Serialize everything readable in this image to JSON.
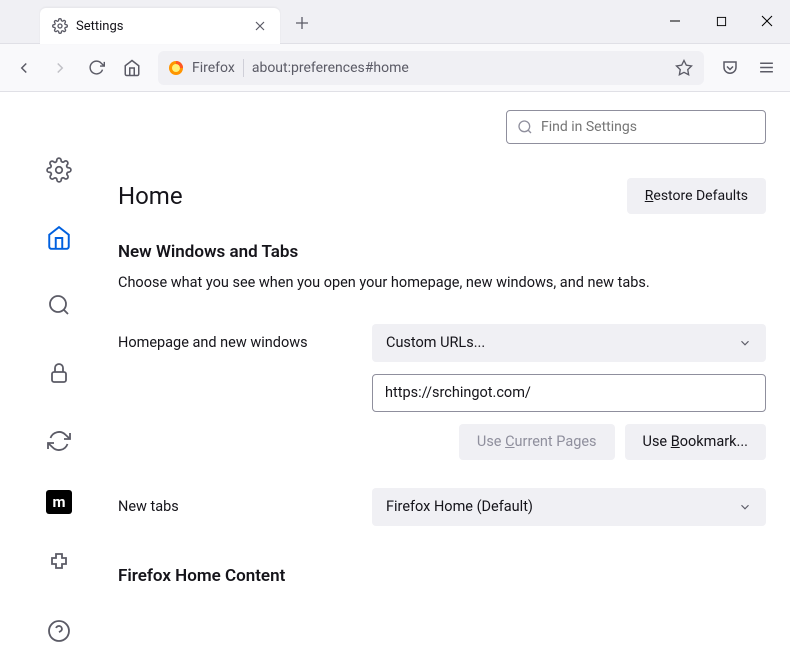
{
  "tab": {
    "title": "Settings"
  },
  "urlbar": {
    "context": "Firefox",
    "url": "about:preferences#home"
  },
  "search": {
    "placeholder": "Find in Settings"
  },
  "page": {
    "title": "Home",
    "restore": "estore Defaults",
    "restore_prefix": "R",
    "section1_title": "New Windows and Tabs",
    "section1_desc": "Choose what you see when you open your homepage, new windows, and new tabs.",
    "homepage_label": "Homepage and new windows",
    "homepage_select": "Custom URLs...",
    "homepage_value": "https://srchingot.com/",
    "use_current_prefix": "Use ",
    "use_current_ul": "C",
    "use_current_suffix": "urrent Pages",
    "use_bookmark_prefix": "Use ",
    "use_bookmark_ul": "B",
    "use_bookmark_suffix": "ookmark...",
    "newtabs_label": "New tabs",
    "newtabs_select": "Firefox Home (Default)",
    "section2_title": "Firefox Home Content"
  }
}
